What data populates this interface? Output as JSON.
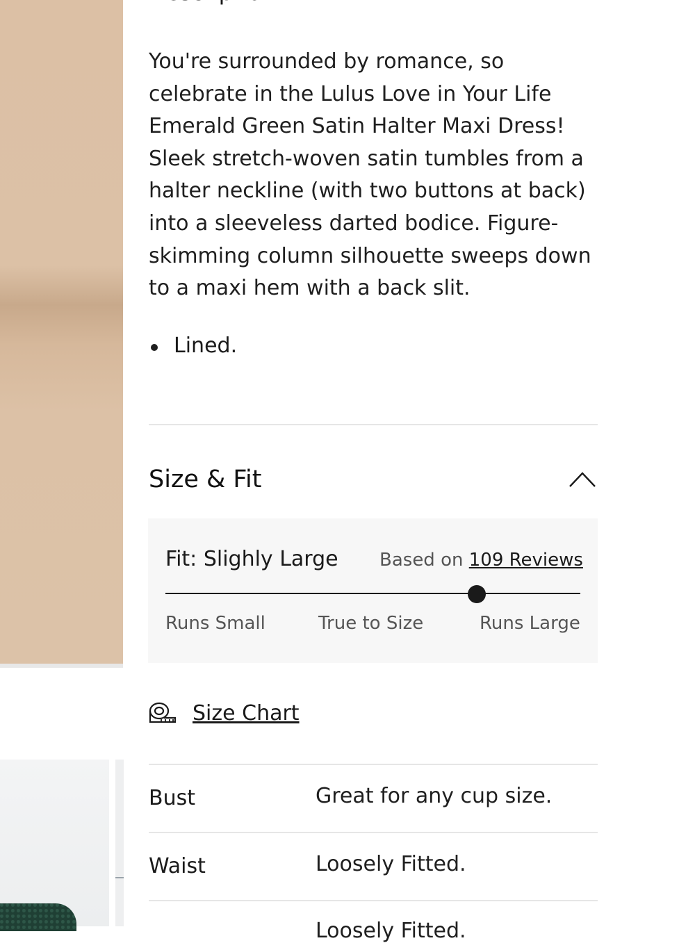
{
  "description": {
    "heading": "Description",
    "body": "You're surrounded by romance, so celebrate in the Lulus Love in Your Life Emerald Green Satin Halter Maxi Dress! Sleek stretch-woven satin tumbles from a halter neckline (with two buttons at back) into a sleeveless darted bodice. Figure-skimming column silhouette sweeps down to a maxi hem with a back slit.",
    "bullets": [
      "Lined."
    ]
  },
  "size_fit": {
    "title": "Size & Fit",
    "fit_label": "Fit: Slighly Large",
    "based_on_prefix": "Based on",
    "reviews_link": "109 Reviews",
    "fit_position": 0.75,
    "scale_labels": [
      "Runs Small",
      "True to Size",
      "Runs Large"
    ],
    "size_chart_label": "Size Chart",
    "rows": [
      {
        "label": "Bust",
        "value": "Great for any cup size."
      },
      {
        "label": "Waist",
        "value": "Loosely Fitted."
      },
      {
        "label": "",
        "value": "Loosely Fitted."
      }
    ]
  },
  "icons": {
    "collapse": "chevron-up-icon",
    "size_chart": "measuring-tape-icon"
  }
}
